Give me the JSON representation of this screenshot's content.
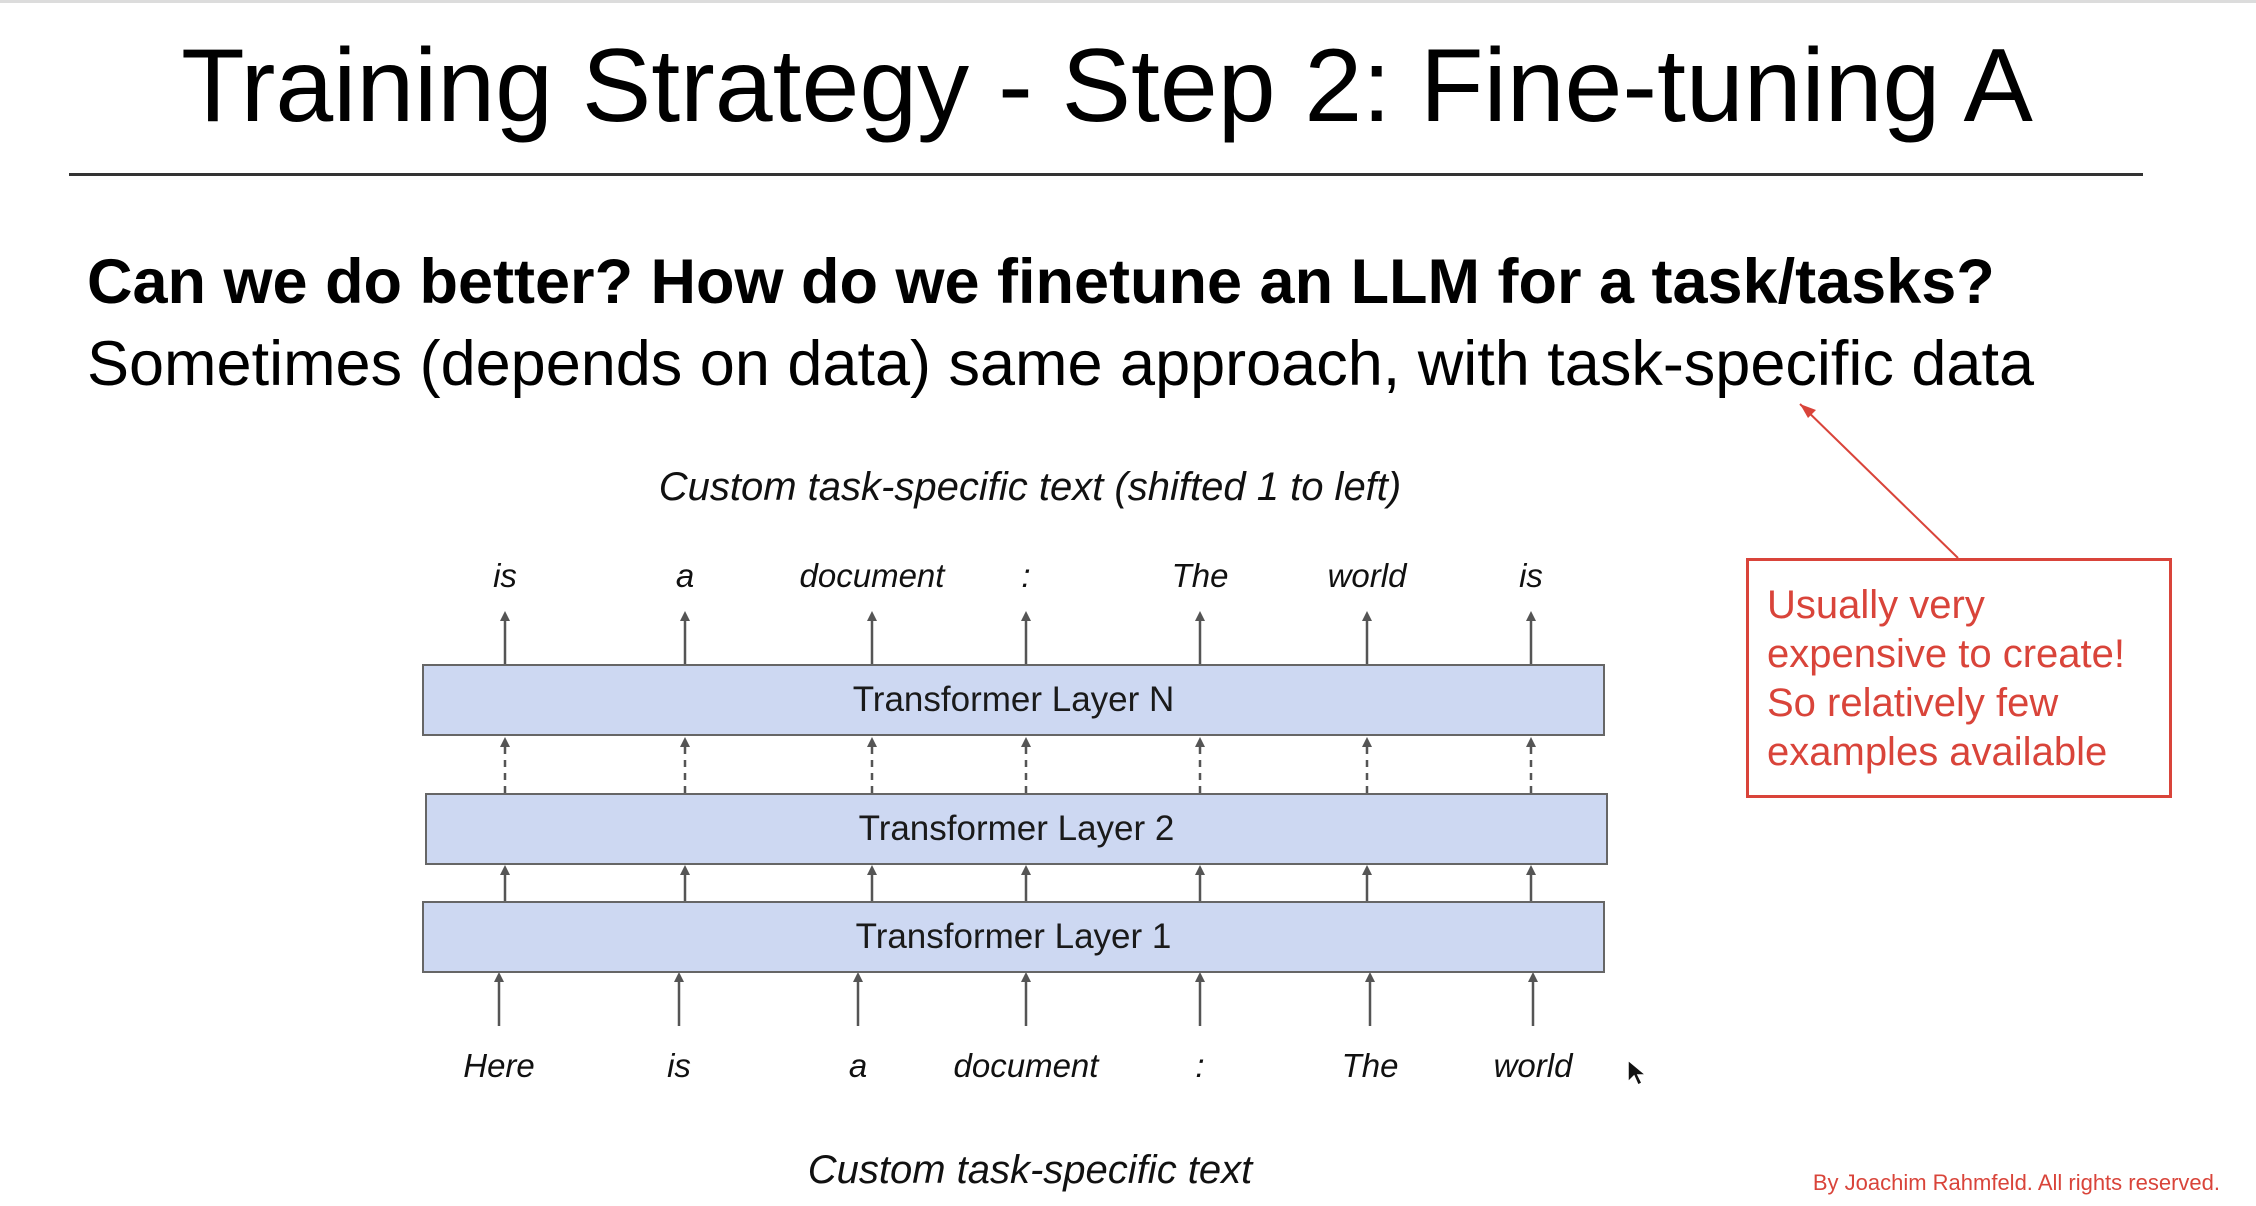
{
  "title": "Training Strategy - Step 2: Fine-tuning A",
  "question": "Can we do better? How do we finetune an LLM for a task/tasks?",
  "subtext": "Sometimes (depends on data) same approach, with task-specific data",
  "diagram": {
    "output_caption": "Custom task-specific text (shifted 1 to left)",
    "input_caption": "Custom task-specific text",
    "output_tokens": [
      "is",
      "a",
      "document",
      ":",
      "The",
      "world",
      "is"
    ],
    "input_tokens": [
      "Here",
      "is",
      "a",
      "document",
      ":",
      "The",
      "world"
    ],
    "layers": {
      "top": "Transformer Layer N",
      "middle": "Transformer Layer 2",
      "bottom": "Transformer Layer 1"
    }
  },
  "callout": {
    "lines": [
      "Usually very",
      "expensive to create!",
      "So relatively few",
      "examples available"
    ]
  },
  "credit": "By Joachim Rahmfeld. All rights reserved.",
  "colors": {
    "layer_fill": "#cdd8f2",
    "accent_red": "#d9443a",
    "arrow": "#555555"
  },
  "icons": {
    "cursor": "mouse-pointer-icon"
  }
}
